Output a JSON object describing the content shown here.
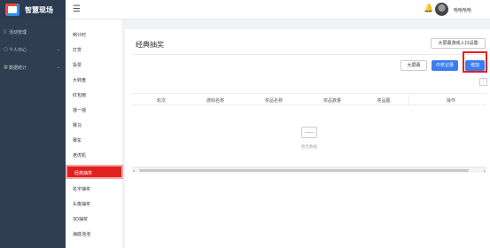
{
  "header": {
    "app_title": "智慧现场",
    "menu_icon": "hamburger-icon",
    "username": "哈哈哈哈"
  },
  "sidebar": {
    "items": [
      {
        "label": "活动管理",
        "icon": "document-icon",
        "has_arrow": false
      },
      {
        "label": "个人中心",
        "icon": "user-icon",
        "has_arrow": true
      },
      {
        "label": "数据统计",
        "icon": "chart-icon",
        "has_arrow": true
      }
    ]
  },
  "submenu": {
    "items": [
      "倒计时",
      "打赏",
      "投票",
      "大转盘",
      "红包雨",
      "摇一摇",
      "赛马",
      "赛车",
      "老虎机",
      "经典抽奖",
      "名字抽奖",
      "头像抽奖",
      "3D抽奖",
      "海底泡泡"
    ],
    "active_index": 9
  },
  "main": {
    "title": "经典抽奖",
    "buttons": {
      "entry_settings": "大屏幕游戏入口设置",
      "big_screen": "大屏幕",
      "winners": "中奖记录",
      "add": "增加"
    },
    "table": {
      "columns": [
        "轮次",
        "游戏名称",
        "奖品名称",
        "奖品数量",
        "奖品图",
        "操作"
      ],
      "rows": [],
      "empty_text": "暂无数据"
    }
  },
  "colors": {
    "sidebar_bg": "#2f3e50",
    "accent_blue": "#3b7df0",
    "highlight_red": "#e12020"
  }
}
